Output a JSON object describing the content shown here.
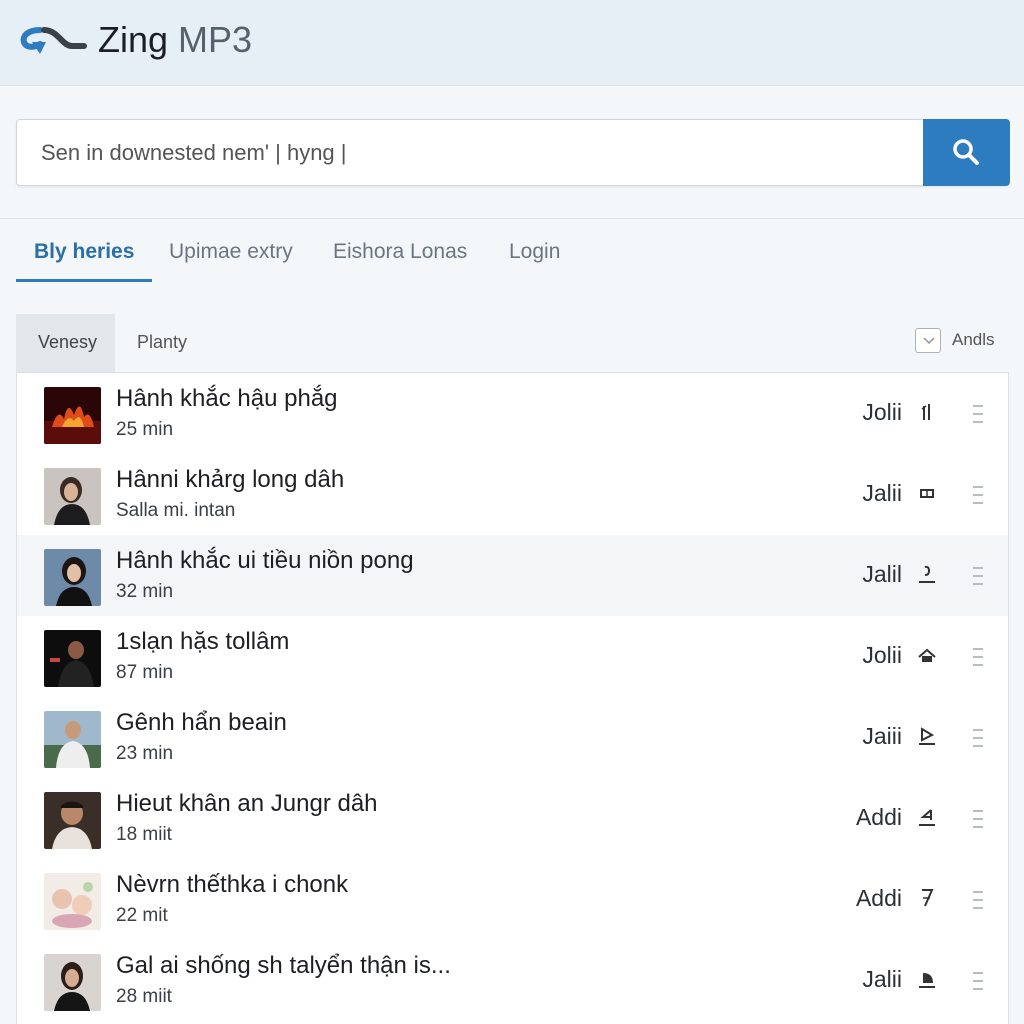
{
  "app": {
    "title_part1": "Zing",
    "title_part2": "MP3",
    "brand_color": "#2e7cc0"
  },
  "search": {
    "placeholder": "Sen in downested nem' | hyng |",
    "button_icon": "search-icon"
  },
  "tabs": [
    {
      "label": "Bly heries",
      "active": true
    },
    {
      "label": "Upimae extry",
      "active": false
    },
    {
      "label": "Eishora Lonas",
      "active": false
    },
    {
      "label": "Login",
      "active": false
    }
  ],
  "list_header": {
    "sub_tabs": [
      {
        "label": "Venesy",
        "active": true
      },
      {
        "label": "Planty",
        "active": false
      }
    ],
    "sort_label": "Andls"
  },
  "songs": [
    {
      "title": "Hânh khắc hậu phắg",
      "sub": "25 min",
      "artist": "Jolii",
      "action_icon": "bars-icon",
      "thumb": "fire-thumbnail"
    },
    {
      "title": "Hânni khảrg long dâh",
      "sub": "Salla mi. intan",
      "artist": "Jalii",
      "action_icon": "ticket-icon",
      "thumb": "woman-portrait-thumbnail"
    },
    {
      "title": "Hânh khắc ui tiều niồn pong",
      "sub": "32 min",
      "artist": "Jalil",
      "action_icon": "download-icon",
      "thumb": "woman-portrait-thumbnail"
    },
    {
      "title": "1slạn hặs tollâm",
      "sub": "87 min",
      "artist": "Jolii",
      "action_icon": "house-icon",
      "thumb": "performer-thumbnail"
    },
    {
      "title": "Gênh hẩn beain",
      "sub": "23 min",
      "artist": "Jaiii",
      "action_icon": "play-icon",
      "thumb": "man-portrait-thumbnail"
    },
    {
      "title": "Hieut khân an Jungr dâh",
      "sub": "18 miit",
      "artist": "Addi",
      "action_icon": "arrow-left-icon",
      "thumb": "man-portrait-thumbnail"
    },
    {
      "title": "Nèvrn thếthka i chonk",
      "sub": "22 mit",
      "artist": "Addi",
      "action_icon": "seven-icon",
      "thumb": "baby-thumbnail"
    },
    {
      "title": "Gal ai shống sh talyển thận is...",
      "sub": "28 miit",
      "artist": "Jalii",
      "action_icon": "pie-icon",
      "thumb": "woman-portrait-thumbnail"
    }
  ]
}
